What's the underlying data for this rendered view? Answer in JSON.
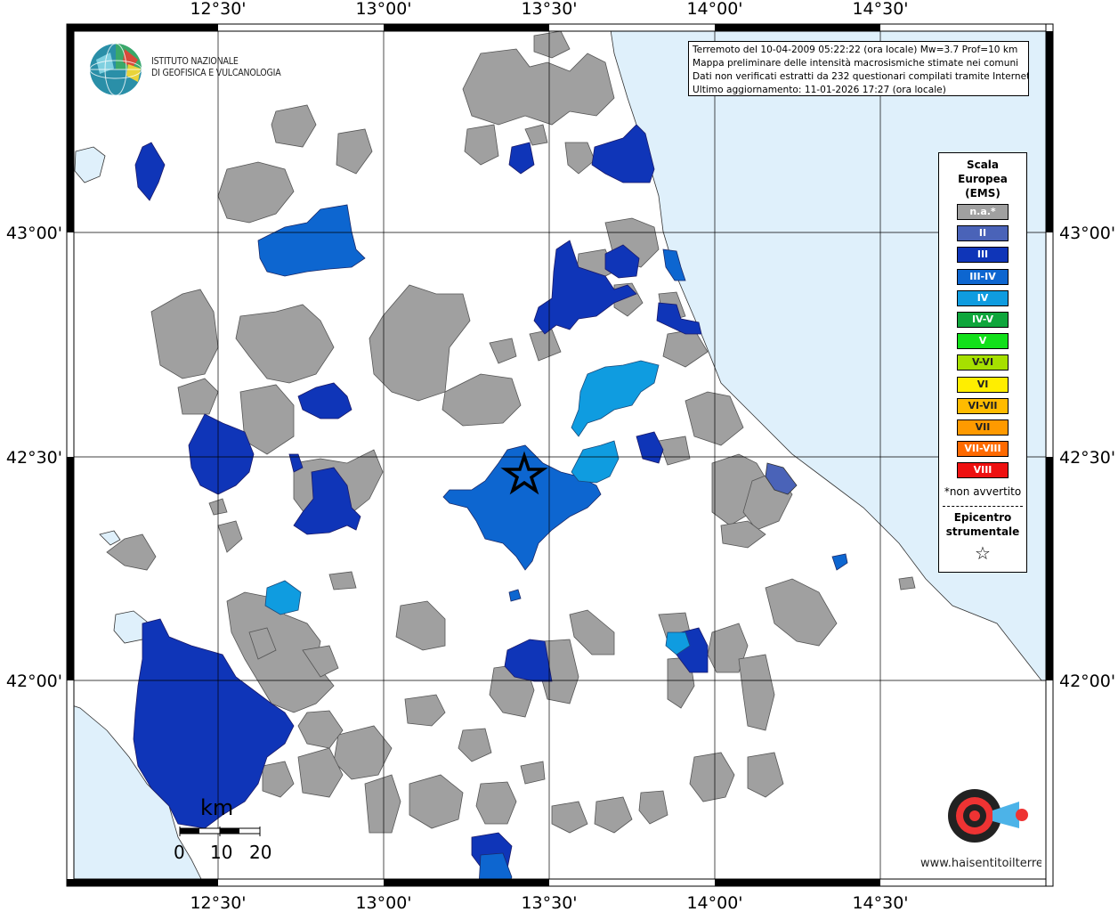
{
  "map": {
    "longitude_labels": [
      "12°30'",
      "13°00'",
      "13°30'",
      "14°00'",
      "14°30'"
    ],
    "latitude_labels": [
      "43°00'",
      "42°30'",
      "42°00'"
    ]
  },
  "info_box": {
    "line1": "Terremoto del 10-04-2009 05:22:22 (ora locale) Mw=3.7 Prof=10 km",
    "line2": "Mappa preliminare delle intensità macrosismiche stimate nei comuni",
    "line3": "Dati non verificati estratti da 232 questionari compilati tramite Internet.",
    "line4": "Ultimo aggiornamento: 11-01-2026 17:27 (ora locale)"
  },
  "ingv_logo": {
    "line1": "ISTITUTO NAZIONALE",
    "line2": "DI GEOFISICA E VULCANOLOGIA"
  },
  "legend": {
    "title_line1": "Scala",
    "title_line2": "Europea",
    "title_line3": "(EMS)",
    "items": [
      {
        "label": "n.a.*",
        "color": "#a0a0a0"
      },
      {
        "label": "II",
        "color": "#4a63b8"
      },
      {
        "label": "III",
        "color": "#0f35b8"
      },
      {
        "label": "III-IV",
        "color": "#0d66d0"
      },
      {
        "label": "IV",
        "color": "#0f9ce0"
      },
      {
        "label": "IV-V",
        "color": "#0fa63c"
      },
      {
        "label": "V",
        "color": "#12e01a"
      },
      {
        "label": "V-VI",
        "color": "#a6e000"
      },
      {
        "label": "VI",
        "color": "#ffee00"
      },
      {
        "label": "VI-VII",
        "color": "#ffbb00"
      },
      {
        "label": "VII",
        "color": "#ff9a00"
      },
      {
        "label": "VII-VIII",
        "color": "#ff6a00"
      },
      {
        "label": "VIII",
        "color": "#ee1111"
      }
    ],
    "note": "*non avvertito",
    "epicenter_line1": "Epicentro",
    "epicenter_line2": "strumentale",
    "epicenter_symbol": "☆"
  },
  "scale_bar": {
    "unit": "km",
    "labels": [
      "0",
      "10",
      "20"
    ]
  },
  "haisentito_logo": {
    "text": "www.haisentitoilterremoto.it"
  },
  "colors": {
    "sea": "#dff0fb",
    "not_felt": "#a0a0a0",
    "III": "#0f35b8",
    "III-IV": "#0d66d0",
    "IV": "#0f9ce0",
    "II": "#4a63b8"
  }
}
